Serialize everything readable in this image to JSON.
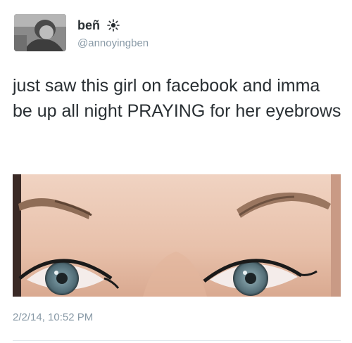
{
  "user": {
    "display_name": "beñ",
    "handle": "@annoyingben",
    "name_icon": "sun-icon"
  },
  "tweet": {
    "text": "just saw this girl on facebook and imma be up all night PRAYING for her eyebrows",
    "timestamp": "2/2/14, 10:52 PM"
  },
  "colors": {
    "text": "#292f33",
    "muted": "#8899a6",
    "divider": "#e1e8ed"
  }
}
